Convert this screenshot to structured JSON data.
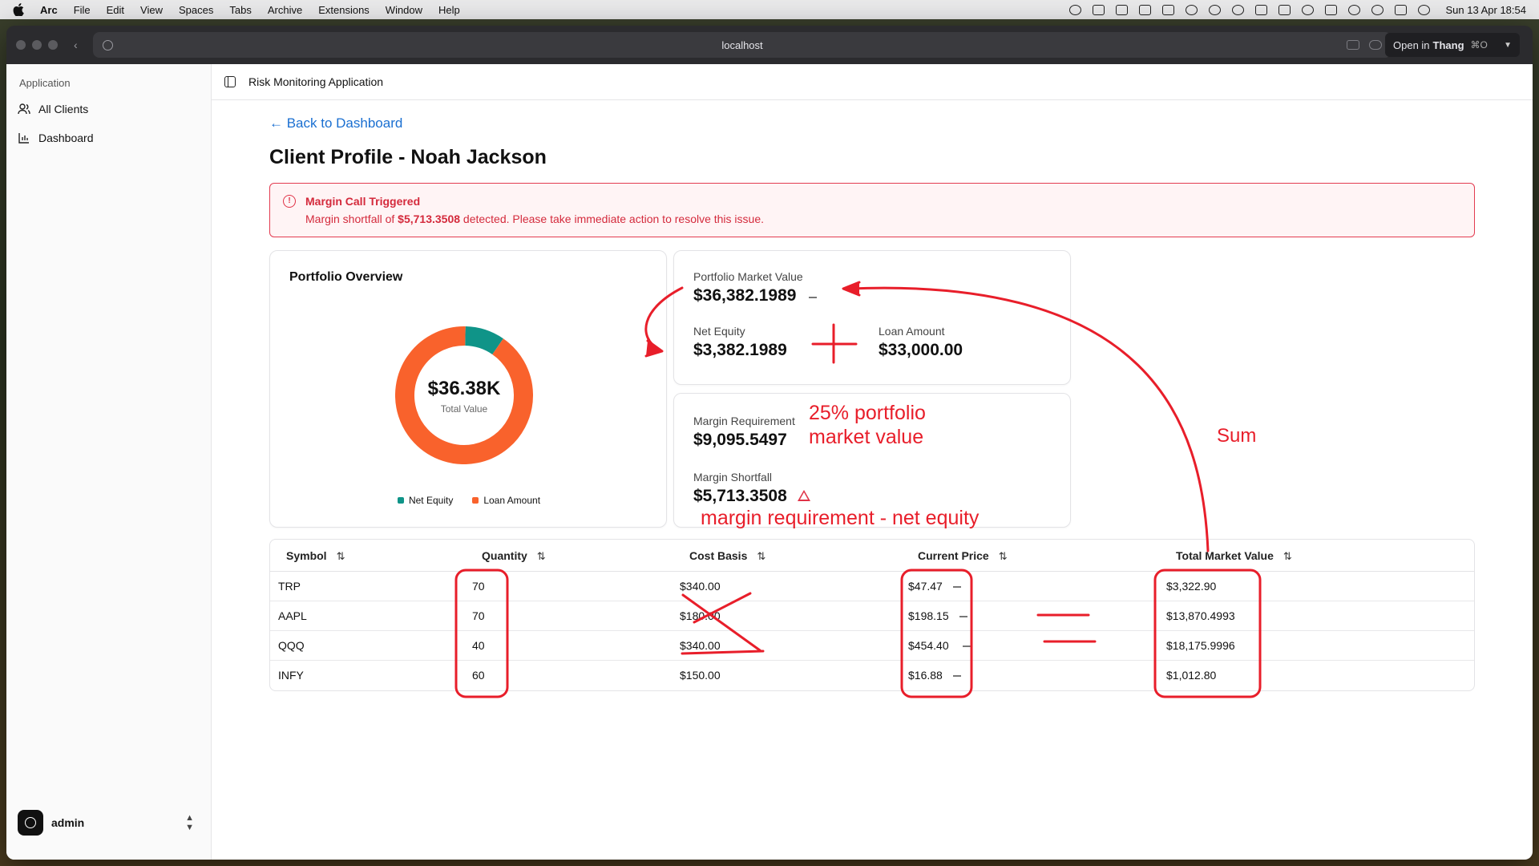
{
  "menubar": {
    "app_name": "Arc",
    "items": [
      "File",
      "Edit",
      "View",
      "Spaces",
      "Tabs",
      "Archive",
      "Extensions",
      "Window",
      "Help"
    ],
    "clock": "Sun 13 Apr  18:54"
  },
  "browser": {
    "url": "localhost",
    "open_in_prefix": "Open in",
    "open_in_target": "Thang",
    "open_in_shortcut": "⌘O"
  },
  "sidebar": {
    "group_label": "Application",
    "items": [
      {
        "label": "All Clients",
        "icon": "users-icon"
      },
      {
        "label": "Dashboard",
        "icon": "chart-icon"
      }
    ],
    "user": "admin"
  },
  "header": {
    "title": "Risk Monitoring Application"
  },
  "page": {
    "back_link": "← Back to Dashboard",
    "title": "Client Profile - Noah Jackson"
  },
  "alert": {
    "title": "Margin Call Triggered",
    "msg_prefix": "Margin shortfall of ",
    "msg_amount": "$5,713.3508",
    "msg_suffix": " detected. Please take immediate action to resolve this issue.",
    "color": "#e03347"
  },
  "overview": {
    "title": "Portfolio Overview",
    "center_value": "$36.38K",
    "center_label": "Total Value",
    "legend": [
      {
        "label": "Net Equity",
        "color": "#0f9488"
      },
      {
        "label": "Loan Amount",
        "color": "#f9622c"
      }
    ]
  },
  "chart_data": {
    "type": "pie",
    "donut": true,
    "categories": [
      "Net Equity",
      "Loan Amount"
    ],
    "values": [
      3382.1989,
      33000.0
    ],
    "colors": [
      "#0f9488",
      "#f9622c"
    ]
  },
  "metrics": {
    "pmv_label": "Portfolio Market Value",
    "pmv_value": "$36,382.1989",
    "equity_label": "Net Equity",
    "equity_value": "$3,382.1989",
    "loan_label": "Loan Amount",
    "loan_value": "$33,000.00",
    "req_label": "Margin Requirement",
    "req_value": "$9,095.5497",
    "shortfall_label": "Margin Shortfall",
    "shortfall_value": "$5,713.3508"
  },
  "table": {
    "headers": [
      "Symbol",
      "Quantity",
      "Cost Basis",
      "Current Price",
      "Total Market Value"
    ],
    "rows": [
      [
        "TRP",
        "70",
        "$340.00",
        "$47.47",
        "$3,322.90"
      ],
      [
        "AAPL",
        "70",
        "$180.00",
        "$198.15",
        "$13,870.4993"
      ],
      [
        "QQQ",
        "40",
        "$340.00",
        "$454.40",
        "$18,175.9996"
      ],
      [
        "INFY",
        "60",
        "$150.00",
        "$16.88",
        "$1,012.80"
      ]
    ]
  },
  "annotations": {
    "pct_line1": "25% portfolio",
    "pct_line2": "market value",
    "sum": "Sum",
    "shortfall_formula": "margin requirement - net equity",
    "color": "#e81e2a"
  }
}
